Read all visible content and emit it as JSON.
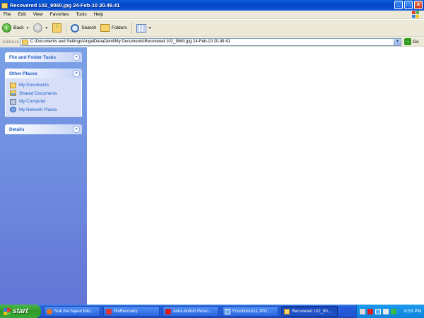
{
  "window": {
    "title": "Recovered 102_9060.jpg 24-Feb-10 20.49.41",
    "controls": {
      "minimize": "_",
      "maximize": "□",
      "close": "×"
    }
  },
  "menu": [
    "File",
    "Edit",
    "View",
    "Favorites",
    "Tools",
    "Help"
  ],
  "toolbar": {
    "back_label": "Back",
    "search_label": "Search",
    "folders_label": "Folders"
  },
  "address": {
    "label": "Address",
    "value": "C:\\Documents and Settings\\AngelDanaDenil\\My Documents\\Recovered 102_9060.jpg 24-Feb-10 20.49.41",
    "go_label": "Go"
  },
  "leftpane": {
    "file_folder_tasks": {
      "title": "File and Folder Tasks"
    },
    "other_places": {
      "title": "Other Places",
      "items": [
        {
          "label": "My Documents",
          "icon": "my-documents-icon"
        },
        {
          "label": "Shared Documents",
          "icon": "shared-documents-icon"
        },
        {
          "label": "My Computer",
          "icon": "my-computer-icon"
        },
        {
          "label": "My Network Places",
          "icon": "network-places-icon"
        }
      ]
    },
    "details": {
      "title": "Details"
    }
  },
  "taskbar": {
    "start_label": "start",
    "tasks": [
      {
        "label": "Nuk me hapen foto...",
        "icon": "firefox-icon"
      },
      {
        "label": "PixRecovery",
        "icon": "pixrecovery-icon"
      },
      {
        "label": "Avira AntiVir Perso...",
        "icon": "avira-icon"
      },
      {
        "label": "Fooottooo111.JPG...",
        "icon": "image-icon"
      },
      {
        "label": "Recovered 102_90...",
        "icon": "folder-icon"
      }
    ],
    "clock": "8:53 PM"
  },
  "colors": {
    "titlebar": "#0347c8",
    "leftpane_top": "#7ba2e7",
    "leftpane_bottom": "#6375d6",
    "link": "#215dc6",
    "start_green": "#3aa637"
  }
}
